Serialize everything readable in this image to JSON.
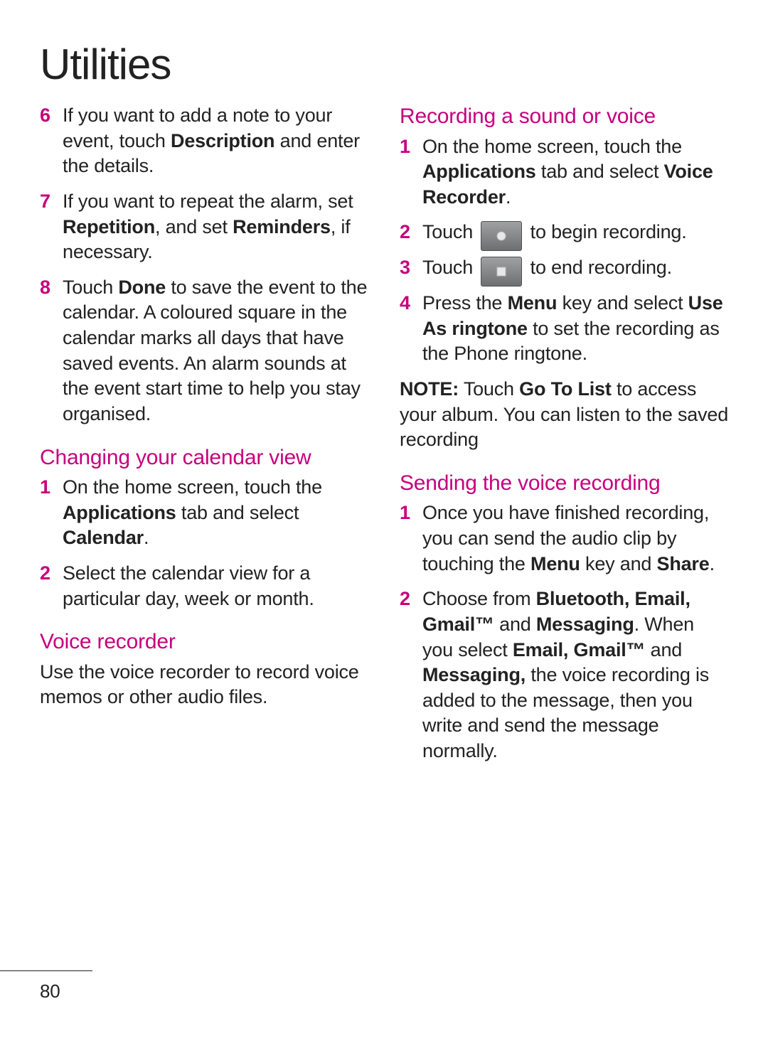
{
  "title": "Utilities",
  "page_number": "80",
  "accent_color": "#C6007E",
  "left": {
    "cont_steps": [
      {
        "n": "6",
        "pre": "If you want to add a note to your event, touch ",
        "b1": "Description",
        "post": " and enter the details."
      },
      {
        "n": "7",
        "pre": "If you want to repeat the alarm, set ",
        "b1": "Repetition",
        "mid": ", and set ",
        "b2": "Reminders",
        "post": ", if necessary."
      },
      {
        "n": "8",
        "pre": "Touch ",
        "b1": "Done",
        "post": " to save the event to the calendar. A coloured square in the calendar marks all days that have saved events. An alarm sounds at the event start time to help you stay organised."
      }
    ],
    "h_changeview": "Changing your calendar view",
    "changeview_steps": [
      {
        "n": "1",
        "pre": "On the home screen, touch the ",
        "b1": "Applications",
        "mid": " tab and select ",
        "b2": "Calendar",
        "post": "."
      },
      {
        "n": "2",
        "pre": "Select the calendar view for a particular day, week or month."
      }
    ],
    "h_voice": "Voice recorder",
    "voice_intro": "Use the voice recorder to record voice memos or other audio files."
  },
  "right": {
    "h_record": "Recording a sound or voice",
    "record_steps": [
      {
        "n": "1",
        "pre": "On the home screen, touch the ",
        "b1": "Applications",
        "mid": " tab and select ",
        "b2": "Voice Recorder",
        "post": "."
      },
      {
        "n": "2",
        "pre": "Touch ",
        "icon": "record",
        "post": " to begin recording."
      },
      {
        "n": "3",
        "pre": "Touch ",
        "icon": "stop",
        "post": " to end recording."
      },
      {
        "n": "4",
        "pre": "Press the ",
        "b1": "Menu",
        "mid": " key and select ",
        "b2": "Use As ringtone",
        "post": " to set the recording as the Phone ringtone."
      }
    ],
    "note_label": "NOTE:",
    "note_pre": " Touch ",
    "note_b": "Go To List",
    "note_post": " to access your album. You can listen to the saved recording",
    "h_send": "Sending the voice recording",
    "send_steps": [
      {
        "n": "1",
        "pre": "Once you have finished recording, you can send the audio clip by touching the ",
        "b1": "Menu",
        "mid": " key and ",
        "b2": "Share",
        "post": "."
      },
      {
        "n": "2",
        "pre": "Choose from ",
        "b1": "Bluetooth, Email, Gmail™",
        "mid": " and ",
        "b2": "Messaging",
        "mid2": ". When you select ",
        "b3": "Email, Gmail™",
        "mid3": " and ",
        "b4": "Messaging,",
        "post": " the voice recording is added to the message, then you write and send the message normally."
      }
    ]
  }
}
